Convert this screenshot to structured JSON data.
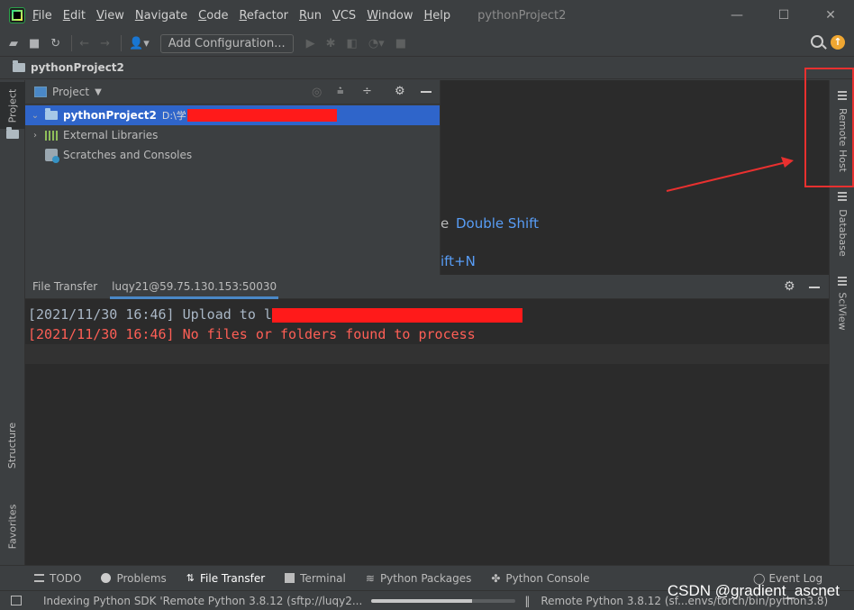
{
  "titlebar": {
    "menu": [
      "File",
      "Edit",
      "View",
      "Navigate",
      "Code",
      "Refactor",
      "Run",
      "VCS",
      "Window",
      "Help"
    ],
    "project_title": "pythonProject2",
    "window_buttons": [
      "—",
      "☐",
      "✕"
    ]
  },
  "toolbar": {
    "add_configuration": "Add Configuration..."
  },
  "breadcrumb": {
    "project": "pythonProject2"
  },
  "left_stripe": {
    "project_tab": "Project",
    "structure_tab": "Structure",
    "favorites_tab": "Favorites"
  },
  "right_stripe": {
    "remote_host_tab": "Remote Host",
    "database_tab": "Database",
    "sciview_tab": "SciView"
  },
  "project_panel": {
    "header": "Project",
    "tree": [
      {
        "label": "pythonProject2",
        "path": "D:\\学习"
      },
      {
        "label": "External Libraries"
      },
      {
        "label": "Scratches and Consoles"
      }
    ]
  },
  "editor": {
    "hint1_suffix": "e",
    "hint1_key": "Double Shift",
    "hint2_key": "ift+N"
  },
  "file_transfer": {
    "tabs": [
      "File Transfer",
      "luqy21@59.75.130.153:50030"
    ],
    "log": [
      {
        "time": "[2021/11/30 16:46]",
        "text": "Upload to l",
        "color": "#a9b7c6"
      },
      {
        "time": "[2021/11/30 16:46]",
        "text": "No files or folders found to process",
        "color": "#ff5f56"
      }
    ]
  },
  "bottom_tabs": [
    "TODO",
    "Problems",
    "File Transfer",
    "Terminal",
    "Python Packages",
    "Python Console",
    "Event Log"
  ],
  "status": {
    "indexing": "Indexing Python SDK 'Remote Python 3.8.12 (sftp://luqy2...",
    "progress": 0.7,
    "interpreter": "Remote Python 3.8.12 (sf...envs/torch/bin/python3.8)"
  },
  "watermark": "CSDN @gradient_ascnet",
  "colors": {
    "accent": "#4a88c7",
    "selection": "#2f65ca",
    "error": "#ff5f56",
    "annotation": "#e8302f"
  }
}
